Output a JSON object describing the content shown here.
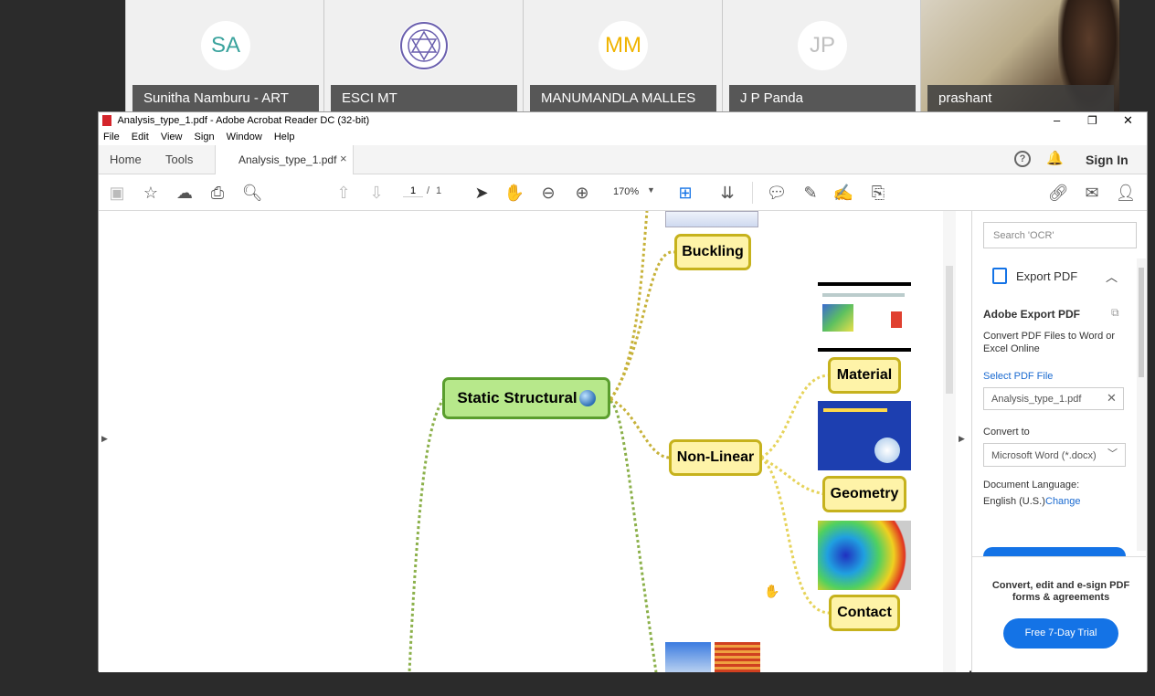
{
  "participants": [
    {
      "initials": "SA",
      "name": "Sunitha Namburu - ART",
      "initials_color": "#3aa39d"
    },
    {
      "initials": "",
      "name": "ESCI MT",
      "initials_color": "#4a3f8c"
    },
    {
      "initials": "MM",
      "name": "MANUMANDLA MALLES",
      "initials_color": "#f0b400"
    },
    {
      "initials": "JP",
      "name": "J P Panda",
      "initials_color": "#c0c0c0"
    },
    {
      "initials": "",
      "name": "prashant",
      "initials_color": ""
    }
  ],
  "window": {
    "title": "Analysis_type_1.pdf - Adobe Acrobat Reader DC (32-bit)",
    "controls": {
      "minimize": "–",
      "maximize": "❐",
      "close": "✕"
    }
  },
  "menu": [
    "File",
    "Edit",
    "View",
    "Sign",
    "Window",
    "Help"
  ],
  "tabs": {
    "home": "Home",
    "tools": "Tools",
    "doc": "Analysis_type_1.pdf",
    "doc_close": "×",
    "sign_in": "Sign In"
  },
  "toolbar": {
    "page_current": "1",
    "page_sep": "/",
    "page_total": "1",
    "zoom": "170%"
  },
  "mindmap": {
    "root": "Static Structural",
    "nodes": [
      "Buckling",
      "Non-Linear",
      "Material",
      "Geometry",
      "Contact"
    ]
  },
  "right_pane": {
    "search_placeholder": "Search 'OCR'",
    "export_pdf": "Export PDF",
    "heading": "Adobe Export PDF",
    "desc": "Convert PDF Files to Word or Excel Online",
    "select_label": "Select PDF File",
    "file": "Analysis_type_1.pdf",
    "convert_to": "Convert to",
    "format": "Microsoft Word (*.docx)",
    "doc_lang_label": "Document Language:",
    "doc_lang": "English (U.S.)",
    "change": "Change",
    "promo": "Convert, edit and e-sign PDF forms & agreements",
    "trial_button": "Free 7-Day Trial"
  },
  "colors": {
    "accent": "#1473e6",
    "node_fill": "#fef3a8",
    "root_fill": "#b7e88b"
  }
}
